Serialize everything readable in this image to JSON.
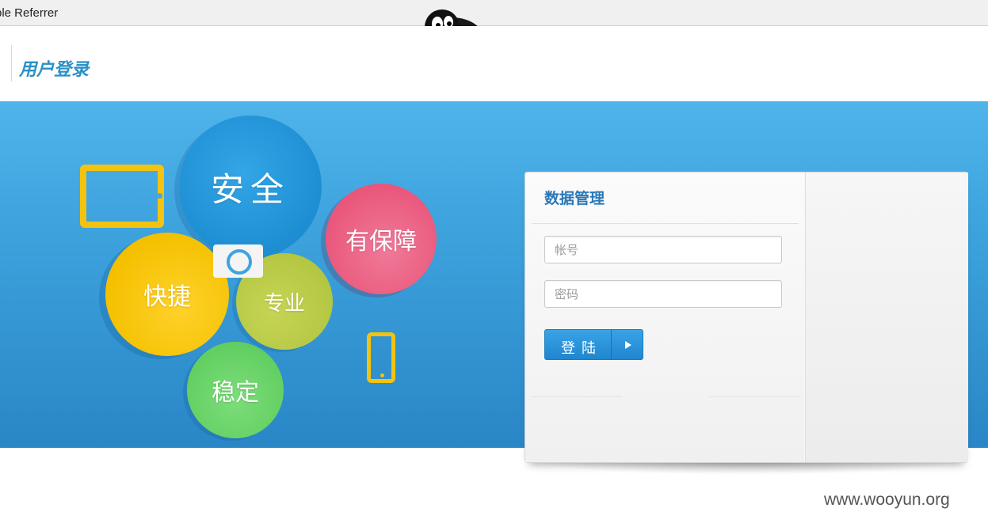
{
  "browser": {
    "toolbar_text": "ble Referrer"
  },
  "header": {
    "title": "用户登录"
  },
  "banner": {
    "bubbles": {
      "safe": "安全",
      "guarantee": "有保障",
      "fast": "快捷",
      "professional": "专业",
      "stable": "稳定"
    }
  },
  "login": {
    "title": "数据管理",
    "username_placeholder": "帐号",
    "password_placeholder": "密码",
    "submit_label": "登陆"
  },
  "watermark": "www.wooyun.org",
  "colors": {
    "banner": "#3a9fda",
    "accent": "#2a90c8",
    "button": "#2a92d8"
  }
}
